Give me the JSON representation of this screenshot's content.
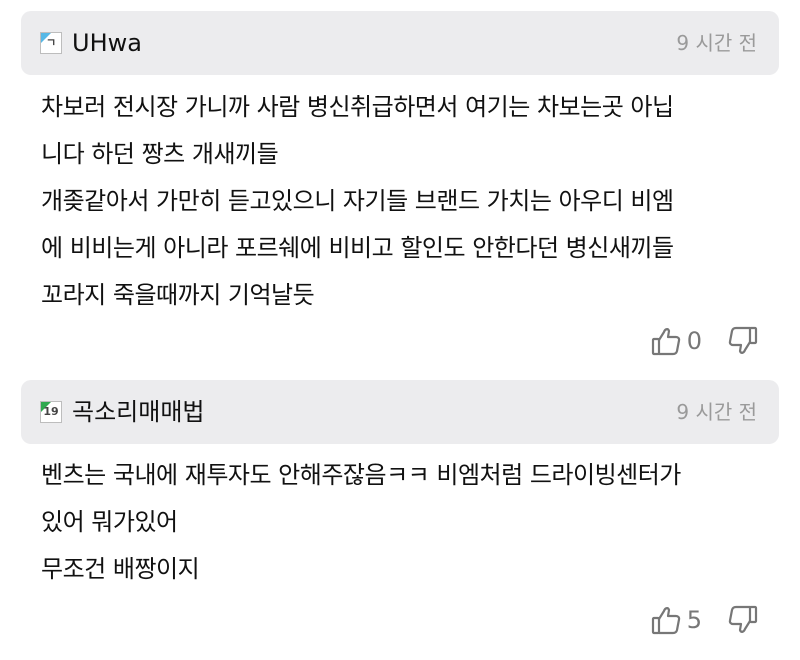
{
  "colors": {
    "header_bg": "#ececee",
    "text": "#111111",
    "timestamp": "#9a9a9a",
    "vote_icon": "#777777",
    "badge_blue": "#56b8e6",
    "badge_green": "#2fa84f"
  },
  "comments": [
    {
      "level_badge": "ㄱ",
      "badge_color": "blue",
      "username": "UHwa",
      "timestamp": "9 시간 전",
      "lines": [
        "차보러 전시장 가니까 사람 병신취급하면서 여기는 차보는곳 아닙",
        "니다 하던 짱츠 개새끼들",
        "개좆같아서 가만히 듣고있으니 자기들 브랜드 가치는 아우디 비엠",
        "에 비비는게 아니라 포르쉐에 비비고 할인도 안한다던 병신새끼들",
        "꼬라지 죽을때까지 기억날듯"
      ],
      "likes": "0",
      "like_icon": "thumbs-up-icon",
      "dislike_icon": "thumbs-down-icon"
    },
    {
      "level_badge": "19",
      "badge_color": "green",
      "username": "곡소리매매법",
      "timestamp": "9 시간 전",
      "lines": [
        "벤츠는 국내에 재투자도 안해주잖음ㅋㅋ 비엠처럼 드라이빙센터가",
        "있어 뭐가있어",
        "무조건 배짱이지"
      ],
      "likes": "5",
      "like_icon": "thumbs-up-icon",
      "dislike_icon": "thumbs-down-icon"
    }
  ]
}
